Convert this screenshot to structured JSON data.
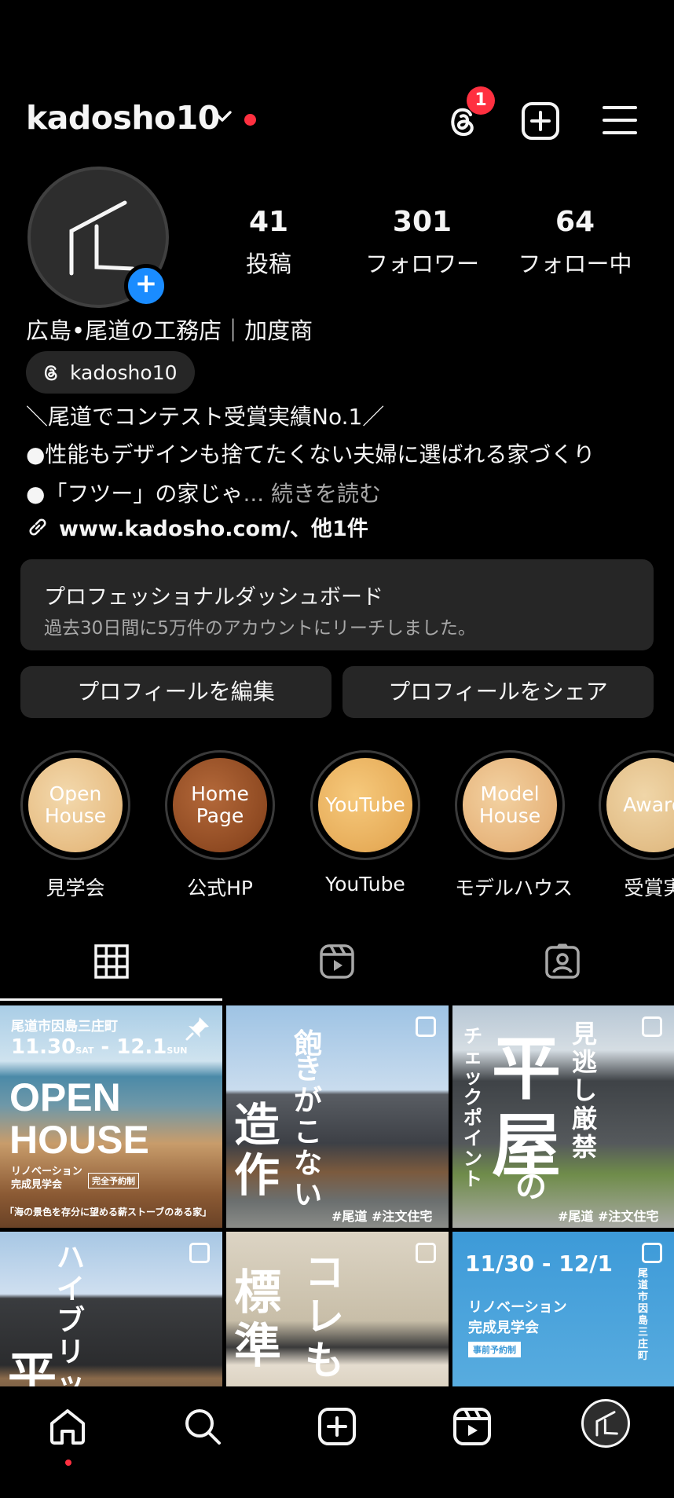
{
  "header": {
    "username": "kadosho10",
    "notification_count": "1"
  },
  "profile": {
    "stats": [
      {
        "num": "41",
        "label": "投稿"
      },
      {
        "num": "301",
        "label": "フォロワー"
      },
      {
        "num": "64",
        "label": "フォロー中"
      }
    ],
    "full_name": "広島•尾道の工務店｜加度商",
    "threads_handle": "kadosho10",
    "bio_lines": [
      "＼尾道でコンテスト受賞実績No.1／",
      "●性能もデザインも捨てたくない夫婦に選ばれる家づくり",
      "●「フツー」の家じゃ"
    ],
    "bio_more": "... 続きを読む",
    "link_text": "www.kadosho.com/、他1件"
  },
  "dashboard": {
    "title": "プロフェッショナルダッシュボード",
    "subtitle": "過去30日間に5万件のアカウントにリーチしました。"
  },
  "buttons": {
    "edit": "プロフィールを編集",
    "share": "プロフィールをシェア"
  },
  "highlights": [
    {
      "cover_text": "Open House",
      "cover_l1": "Open",
      "cover_l2": "House",
      "caption": "見学会"
    },
    {
      "cover_text": "Home Page",
      "cover_l1": "Home",
      "cover_l2": "Page",
      "caption": "公式HP"
    },
    {
      "cover_text": "YouTube",
      "cover_l1": "YouTube",
      "cover_l2": "",
      "caption": "YouTube"
    },
    {
      "cover_text": "Model House",
      "cover_l1": "Model",
      "cover_l2": "House",
      "caption": "モデルハウス"
    },
    {
      "cover_text": "Award",
      "cover_l1": "Award",
      "cover_l2": "",
      "caption": "受賞実"
    }
  ],
  "posts": [
    {
      "l1": "尾道市因島三庄町",
      "l2": "11.30",
      "l2b": "SAT",
      "l3": "12.1",
      "l3b": "SUN",
      "big1": "OPEN",
      "big2": "HOUSE",
      "sub1": "リノベーション",
      "sub2": "完成見学会",
      "sub3": "完全予約制",
      "foot": "「海の景色を存分に望める薪ストーブのある家」"
    },
    {
      "v1": "飽",
      "v2": "きがこない",
      "big": "造作",
      "tags": "#尾道 #注文住宅"
    },
    {
      "v1": "見逃し厳禁",
      "big1": "平",
      "big2": "屋",
      "no": "の",
      "v2": "チェックポイント",
      "tags": "#尾道 #注文住宅"
    },
    {
      "v1": "ハイブリッ",
      "big": "平"
    },
    {
      "v1": "コレも",
      "big": "標準"
    },
    {
      "l1": "11/30 - 12/1",
      "l2": "リノベーション",
      "l3": "完成見学会",
      "l4": "事前予約制",
      "side": "尾道市因島三庄町"
    }
  ]
}
